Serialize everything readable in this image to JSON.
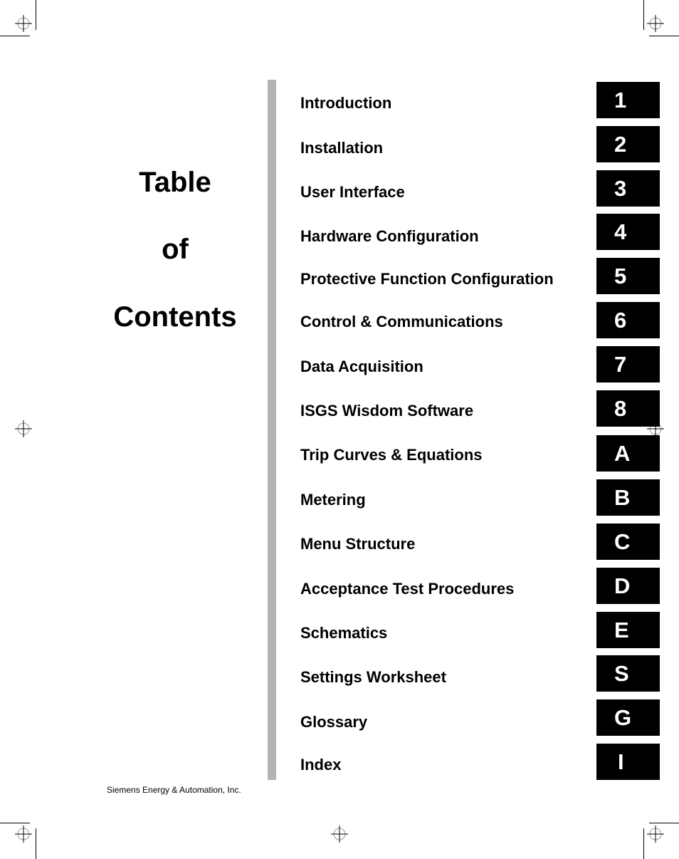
{
  "page": {
    "side_title": [
      "Table",
      "of",
      "Contents"
    ],
    "footer_text": "Siemens Energy & Automation, Inc.",
    "colors": {
      "tab_background": "#000000",
      "tab_text": "#ffffff",
      "divider_bar": "#b3b3b3"
    }
  },
  "toc": {
    "entries": [
      {
        "title": "Introduction",
        "tab": "1"
      },
      {
        "title": "Installation",
        "tab": "2"
      },
      {
        "title": "User Interface",
        "tab": "3"
      },
      {
        "title": "Hardware Configuration",
        "tab": "4"
      },
      {
        "title": "Protective Function Configuration",
        "tab": "5"
      },
      {
        "title": "Control & Communications",
        "tab": "6"
      },
      {
        "title": "Data Acquisition",
        "tab": "7"
      },
      {
        "title": "ISGS Wisdom Software",
        "tab": "8"
      },
      {
        "title": "Trip Curves & Equations",
        "tab": "A"
      },
      {
        "title": "Metering",
        "tab": "B"
      },
      {
        "title": "Menu Structure",
        "tab": "C"
      },
      {
        "title": "Acceptance Test Procedures",
        "tab": "D"
      },
      {
        "title": "Schematics",
        "tab": "E"
      },
      {
        "title": "Settings Worksheet",
        "tab": "S"
      },
      {
        "title": "Glossary",
        "tab": "G"
      },
      {
        "title": "Index",
        "tab": "I"
      }
    ]
  }
}
